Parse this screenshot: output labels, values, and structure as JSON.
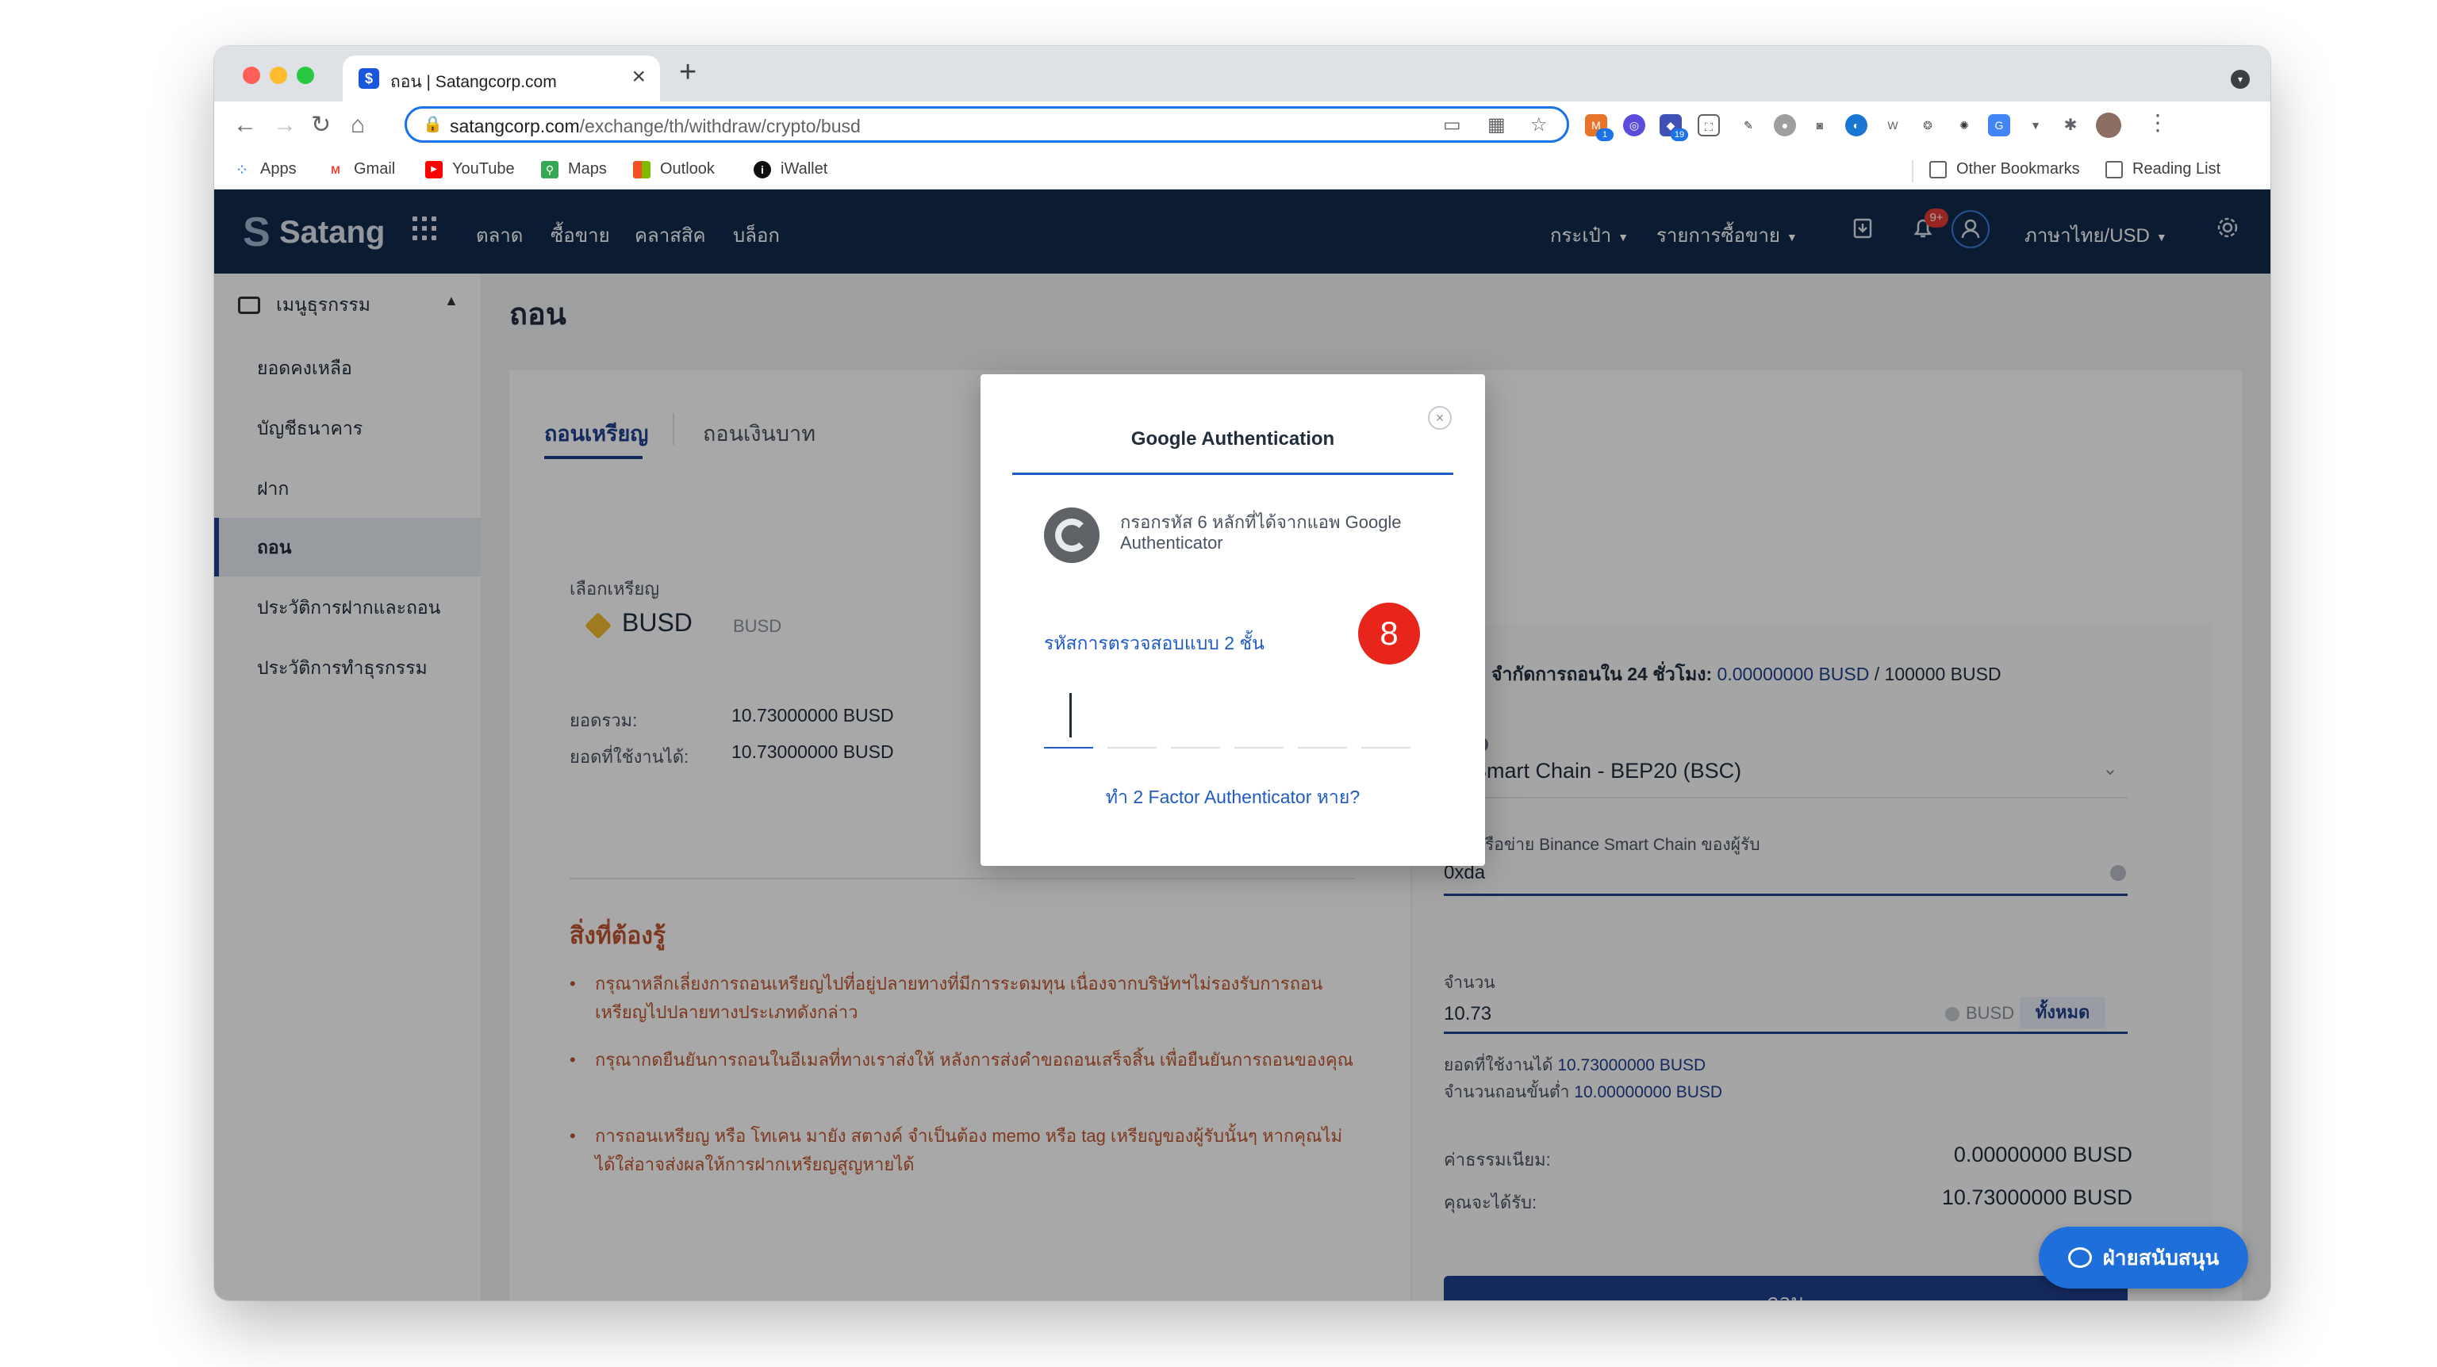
{
  "browser": {
    "tab_title": "ถอน | Satangcorp.com",
    "url_host": "satangcorp.com",
    "url_path": "/exchange/th/withdraw/crypto/busd",
    "extension_badges": [
      "1",
      "19"
    ],
    "bookmarks": [
      "Apps",
      "Gmail",
      "YouTube",
      "Maps",
      "Outlook",
      "iWallet"
    ],
    "other_bookmarks": "Other Bookmarks",
    "reading_list": "Reading List"
  },
  "navbar": {
    "logo": "Satang",
    "links": [
      "ตลาด",
      "ซื้อขาย",
      "คลาสสิค",
      "บล็อก"
    ],
    "wallet": "กระเป๋า",
    "orders": "รายการซื้อขาย",
    "notification_count": "9+",
    "language": "ภาษาไทย/USD"
  },
  "sidebar": {
    "header": "เมนูธุรกรรม",
    "items": [
      "ยอดคงเหลือ",
      "บัญชีธนาคาร",
      "ฝาก",
      "ถอน",
      "ประวัติการฝากและถอน",
      "ประวัติการทำธุรกรรม"
    ],
    "active_index": 3
  },
  "page": {
    "title": "ถอน",
    "tabs": [
      "ถอนเหรียญ",
      "ถอนเงินบาท"
    ],
    "select_coin_label": "เลือกเหรียญ",
    "coin_name": "BUSD",
    "coin_symbol": "BUSD",
    "total_label": "ยอดรวม:",
    "total_value": "10.73000000 BUSD",
    "available_label": "ยอดที่ใช้งานได้:",
    "available_value": "10.73000000 BUSD",
    "notes_title": "สิ่งที่ต้องรู้",
    "notes": [
      "กรุณาหลีกเลี่ยงการถอนเหรียญไปที่อยู่ปลายทางที่มีการระดมทุน เนื่องจากบริษัทฯไม่รองรับการถอนเหรียญไปปลายทางประเภทดังกล่าว",
      "กรุณากดยืนยันการถอนในอีเมลที่ทางเราส่งให้ หลังการส่งคำขอถอนเสร็จสิ้น เพื่อยืนยันการถอนของคุณ",
      "การถอนเหรียญ หรือ โทเคน มายัง สตางค์ จำเป็นต้อง memo หรือ tag เหรียญของผู้รับนั้นๆ หากคุณไม่ได้ใส่อาจส่งผลให้การฝากเหรียญสูญหายได้"
    ]
  },
  "withdraw_form": {
    "limit_label": "จำกัดการถอนใน 24 ชั่วโมง:",
    "limit_used": "0.00000000 BUSD",
    "limit_sep": "/",
    "limit_max": "100000 BUSD",
    "network_label": "าย",
    "network_value": "ce Smart Chain - BEP20 (BSC)",
    "address_label": "อยู่ เครือข่าย Binance Smart Chain ของผู้รับ",
    "address_value": "0xda",
    "amount_label": "จำนวน",
    "amount_value": "10.73",
    "amount_unit": "BUSD",
    "all_button": "ทั้งหมด",
    "available_label": "ยอดที่ใช้งานได้",
    "available_value": "10.73000000 BUSD",
    "min_label": "จำนวนถอนขั้นต่ำ",
    "min_value": "10.00000000 BUSD",
    "fee_label": "ค่าธรรมเนียม:",
    "fee_value": "0.00000000 BUSD",
    "receive_label": "คุณจะได้รับ:",
    "receive_value": "10.73000000 BUSD",
    "submit": "ถอน"
  },
  "support_button": "ฝ่ายสนับสนุน",
  "modal": {
    "title": "Google Authentication",
    "instruction": "กรอกรหัส 6 หลักที่ได้จากแอพ Google Authenticator",
    "code_label": "รหัสการตรวจสอบแบบ 2 ชั้น",
    "step_number": "8",
    "lost_link": "ทำ 2 Factor Authenticator หาย?"
  },
  "colors": {
    "navbar": "#102a4c",
    "primary": "#1f3f8f",
    "warning_text": "#c0562f",
    "step_badge": "#e8251b"
  }
}
